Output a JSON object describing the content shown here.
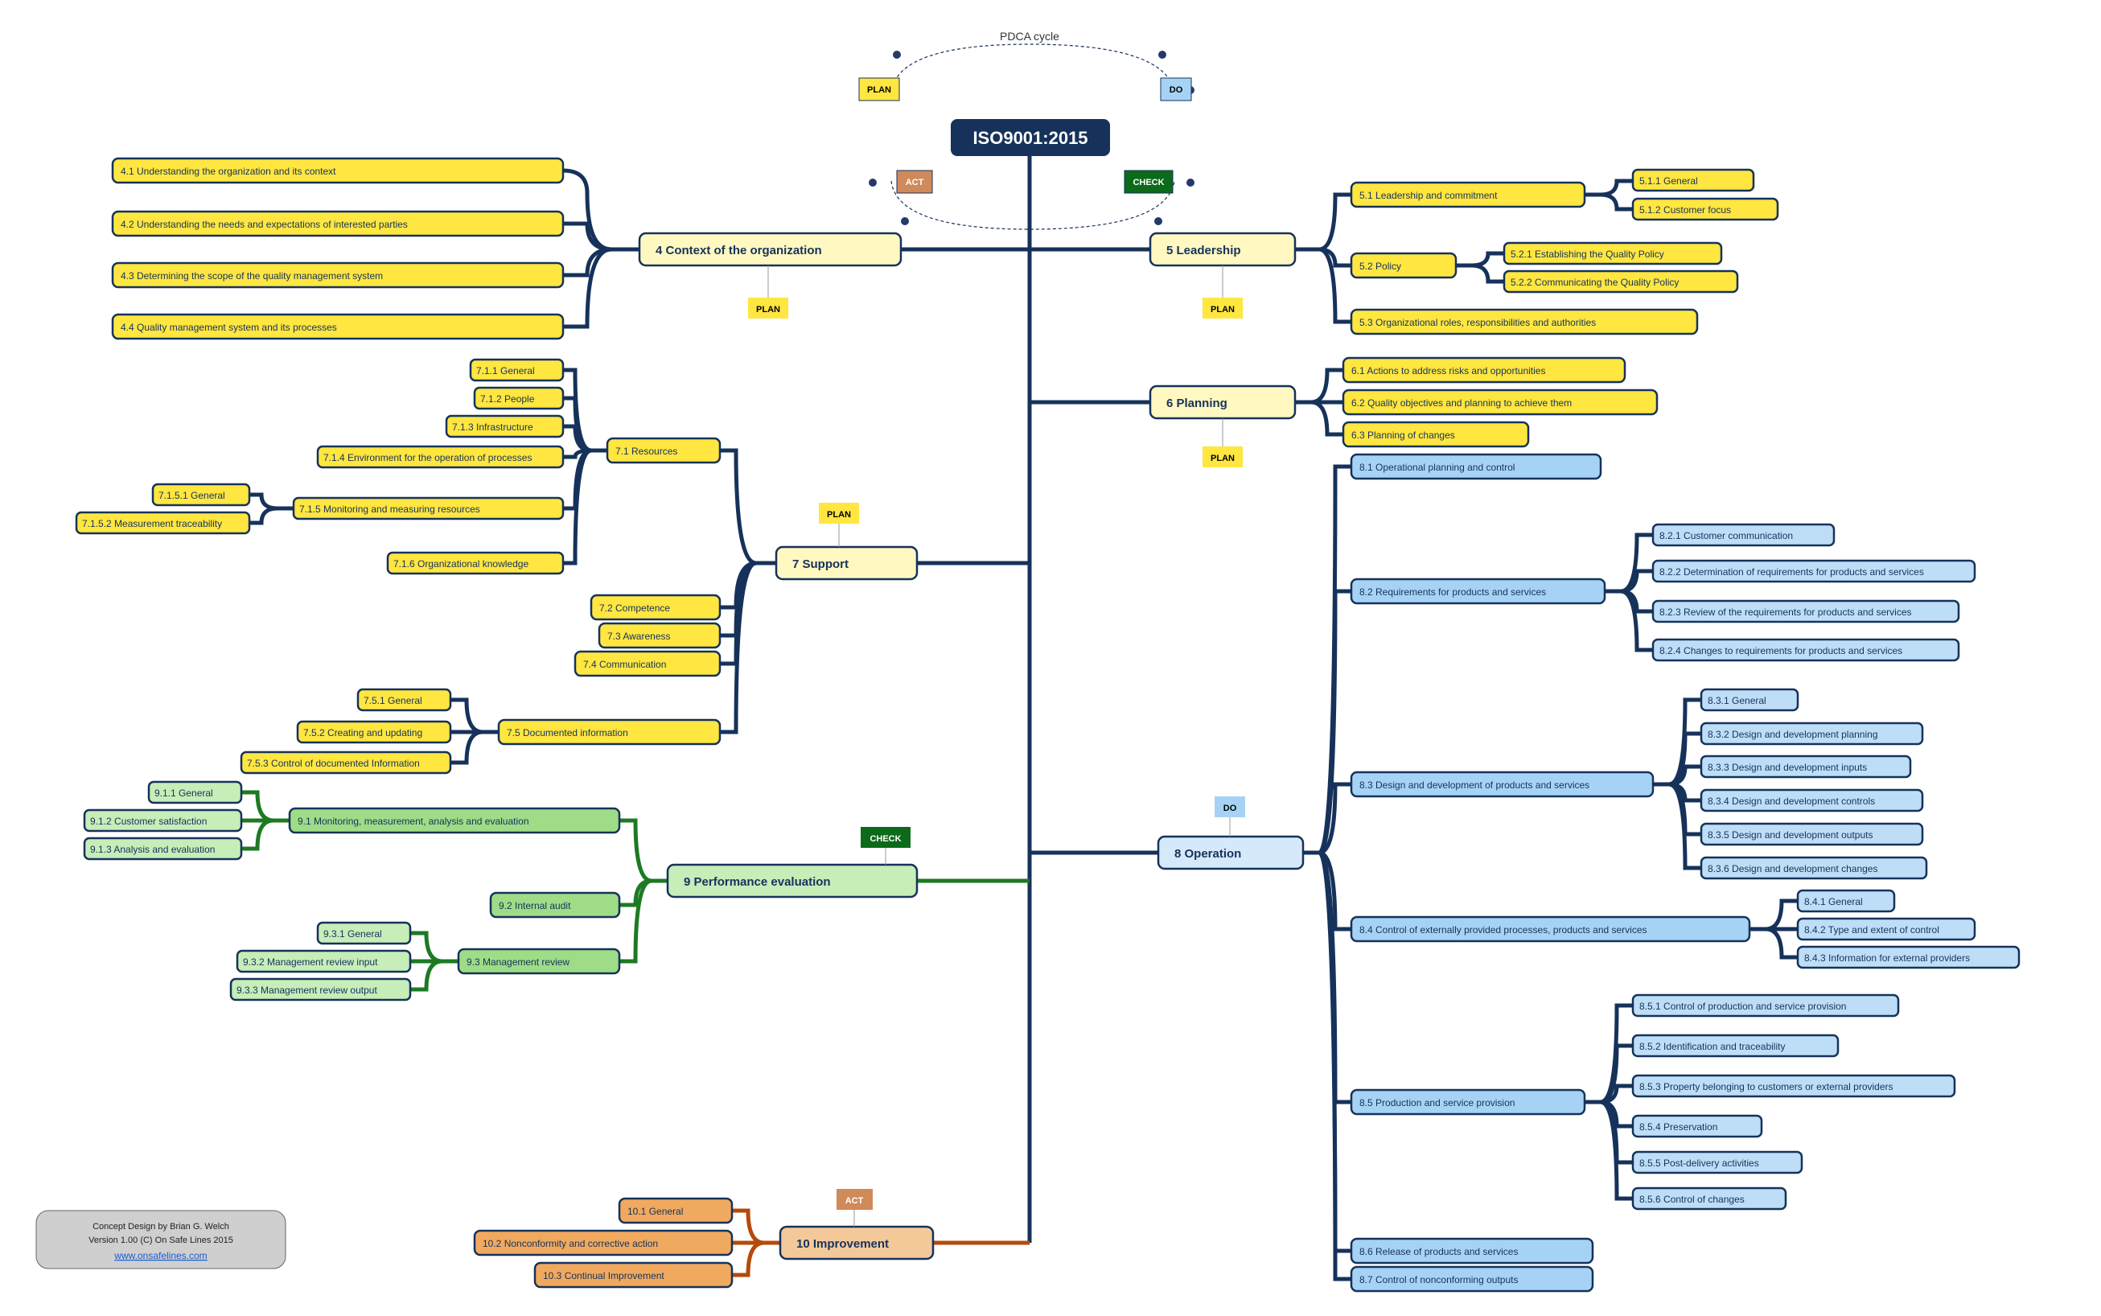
{
  "title": "ISO9001:2015",
  "pdca": {
    "label": "PDCA cycle",
    "plan": "PLAN",
    "do": "DO",
    "check": "CHECK",
    "act": "ACT"
  },
  "tags": {
    "plan": "PLAN",
    "do": "DO",
    "check": "CHECK",
    "act": "ACT"
  },
  "credits": {
    "l1": "Concept Design by Brian G. Welch",
    "l2": "Version 1.00 (C) On Safe Lines 2015",
    "link": "www.onsafelines.com"
  },
  "sections": {
    "s4": {
      "title": "4      Context of the organization",
      "items": [
        "4.1    Understanding the organization and its context",
        "4.2    Understanding the needs and expectations of interested parties",
        "4.3    Determining the scope of the quality management system",
        "4.4    Quality management system and its  processes"
      ]
    },
    "s5": {
      "title": "5      Leadership",
      "s51": "5.1    Leadership and commitment",
      "s511": "5.1.1  General",
      "s512": "5.1.2  Customer focus",
      "s52": "5.2    Policy",
      "s521": "5.2.1  Establishing the Quality Policy",
      "s522": "5.2.2  Communicating the Quality Policy",
      "s53": "5.3    Organizational roles, responsibilities and  authorities"
    },
    "s6": {
      "title": "6      Planning",
      "items": [
        "6.1    Actions to address risks and opportunities",
        "6.2    Quality objectives and planning to achieve them",
        "6.3    Planning of changes"
      ]
    },
    "s7": {
      "title": "7      Support",
      "s71": "7.1    Resources",
      "s71items": [
        "7.1.1  General",
        "7.1.2  People",
        "7.1.3  Infrastructure",
        "7.1.4  Environment for the operation of processes",
        "7.1.5  Monitoring and measuring resources",
        "7.1.6  Organizational knowledge"
      ],
      "s7151": "7.1.5.1  General",
      "s7152": "7.1.5.2  Measurement traceability",
      "s72": "7.2    Competence",
      "s73": "7.3    Awareness",
      "s74": "7.4    Communication",
      "s75": "7.5    Documented information",
      "s75items": [
        "7.5.1  General",
        "7.5.2  Creating and updating",
        "7.5.3  Control of documented Information"
      ]
    },
    "s8": {
      "title": "8      Operation",
      "s81": "8.1    Operational planning and control",
      "s82": "8.2    Requirements for products and services",
      "s82items": [
        "8.2.1  Customer communication",
        "8.2.2  Determination of requirements for products and services",
        "8.2.3  Review of the requirements for products and services",
        "8.2.4  Changes to requirements for products and services"
      ],
      "s83": "8.3    Design and development of products and services",
      "s83items": [
        "8.3.1  General",
        "8.3.2  Design and development planning",
        "8.3.3  Design and development inputs",
        "8.3.4  Design and development controls",
        "8.3.5  Design and development outputs",
        "8.3.6  Design and development changes"
      ],
      "s84": "8.4    Control of externally provided processes, products and services",
      "s84items": [
        "8.4.1  General",
        "8.4.2  Type and extent of control",
        "8.4.3  Information for external providers"
      ],
      "s85": "8.5    Production and service provision",
      "s85items": [
        "8.5.1  Control of production and service provision",
        "8.5.2  Identification and traceability",
        "8.5.3  Property belonging to customers or external providers",
        "8.5.4  Preservation",
        "8.5.5  Post-delivery activities",
        "8.5.6  Control of changes"
      ],
      "s86": "8.6    Release of products and services",
      "s87": "8.7    Control of nonconforming outputs"
    },
    "s9": {
      "title": "9      Performance evaluation",
      "s91": "9.1    Monitoring, measurement, analysis and evaluation",
      "s91items": [
        "9.1.1  General",
        "9.1.2  Customer satisfaction",
        "9.1.3  Analysis and evaluation"
      ],
      "s92": "9.2    Internal audit",
      "s93": "9.3    Management review",
      "s93items": [
        "9.3.1  General",
        "9.3.2  Management review input",
        "9.3.3  Management review output"
      ]
    },
    "s10": {
      "title": "10      Improvement",
      "items": [
        "10.1    General",
        "10.2    Nonconformity and corrective action",
        "10.3    Continual Improvement"
      ]
    }
  }
}
